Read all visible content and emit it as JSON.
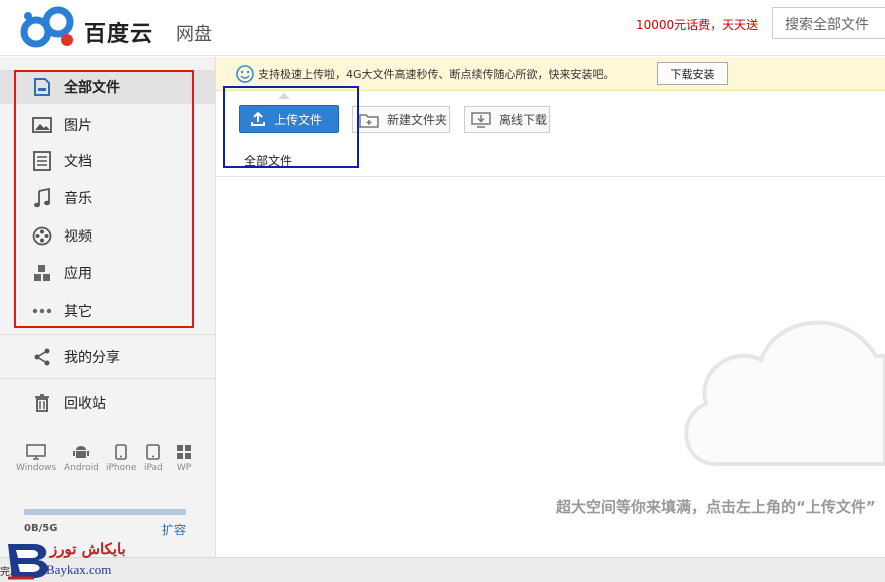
{
  "header": {
    "brand": "百度云",
    "brand_sub": "网盘",
    "promo": "10000元话费，天天送",
    "search_placeholder": "搜索全部文件"
  },
  "sidebar": {
    "items": [
      {
        "label": "全部文件",
        "icon": "document-icon",
        "active": true
      },
      {
        "label": "图片",
        "icon": "image-icon"
      },
      {
        "label": "文档",
        "icon": "doc-list-icon"
      },
      {
        "label": "音乐",
        "icon": "music-icon"
      },
      {
        "label": "视频",
        "icon": "film-reel-icon"
      },
      {
        "label": "应用",
        "icon": "app-blocks-icon"
      },
      {
        "label": "其它",
        "icon": "more-dots-icon"
      }
    ],
    "share": {
      "label": "我的分享",
      "icon": "share-icon"
    },
    "trash": {
      "label": "回收站",
      "icon": "trash-icon"
    },
    "devices": [
      "Windows",
      "Android",
      "iPhone",
      "iPad",
      "WP"
    ],
    "storage": "0B/5G",
    "expand": "扩容"
  },
  "notice": {
    "text": "支持极速上传啦，4G大文件高速秒传、断点续传随心所欲，快来安装吧。",
    "button": "下载安装"
  },
  "toolbar": {
    "upload": "上传文件",
    "new_folder": "新建文件夹",
    "offline": "离线下载"
  },
  "breadcrumb": "全部文件",
  "empty_text": "超大空间等你来填满，点击左上角的“上传文件”",
  "statusbar": {
    "text": "完成"
  },
  "watermark": {
    "brand": "بايكاش تورز",
    "url": "Baykax.com"
  },
  "colors": {
    "accent": "#2f80d2",
    "promo": "#c00000",
    "annotation_red": "#e3161d",
    "annotation_blue": "#1020a8"
  }
}
